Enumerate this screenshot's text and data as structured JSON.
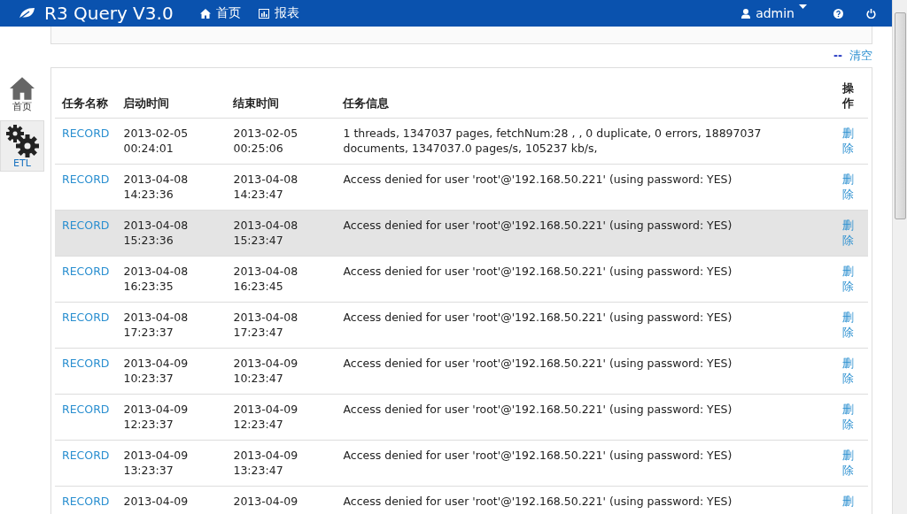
{
  "header": {
    "brand": "R3 Query V3.0",
    "nav": [
      {
        "label": "首页"
      },
      {
        "label": "报表"
      }
    ],
    "user": "admin"
  },
  "sidebar": {
    "items": [
      {
        "label": "首页",
        "selected": false
      },
      {
        "label": "ETL",
        "selected": true
      }
    ]
  },
  "toolbar": {
    "clear_prefix": "--",
    "clear": "清空"
  },
  "table": {
    "columns": [
      "任务名称",
      "启动时间",
      "结束时间",
      "任务信息",
      "操作"
    ],
    "rows": [
      {
        "name": "RECORD",
        "start": [
          "2013-02-05",
          "00:24:01"
        ],
        "end": [
          "2013-02-05",
          "00:25:06"
        ],
        "info": "1 threads, 1347037 pages, fetchNum:28 , , 0 duplicate, 0 errors, 18897037 documents, 1347037.0 pages/s, 105237 kb/s,",
        "action": "删除",
        "selected": false
      },
      {
        "name": "RECORD",
        "start": [
          "2013-04-08",
          "14:23:36"
        ],
        "end": [
          "2013-04-08",
          "14:23:47"
        ],
        "info": "Access denied for user 'root'@'192.168.50.221' (using password: YES)",
        "action": "删除",
        "selected": false
      },
      {
        "name": "RECORD",
        "start": [
          "2013-04-08",
          "15:23:36"
        ],
        "end": [
          "2013-04-08",
          "15:23:47"
        ],
        "info": "Access denied for user 'root'@'192.168.50.221' (using password: YES)",
        "action": "删除",
        "selected": true
      },
      {
        "name": "RECORD",
        "start": [
          "2013-04-08",
          "16:23:35"
        ],
        "end": [
          "2013-04-08",
          "16:23:45"
        ],
        "info": "Access denied for user 'root'@'192.168.50.221' (using password: YES)",
        "action": "删除",
        "selected": false
      },
      {
        "name": "RECORD",
        "start": [
          "2013-04-08",
          "17:23:37"
        ],
        "end": [
          "2013-04-08",
          "17:23:47"
        ],
        "info": "Access denied for user 'root'@'192.168.50.221' (using password: YES)",
        "action": "删除",
        "selected": false
      },
      {
        "name": "RECORD",
        "start": [
          "2013-04-09",
          "10:23:37"
        ],
        "end": [
          "2013-04-09",
          "10:23:47"
        ],
        "info": "Access denied for user 'root'@'192.168.50.221' (using password: YES)",
        "action": "删除",
        "selected": false
      },
      {
        "name": "RECORD",
        "start": [
          "2013-04-09",
          "12:23:37"
        ],
        "end": [
          "2013-04-09",
          "12:23:47"
        ],
        "info": "Access denied for user 'root'@'192.168.50.221' (using password: YES)",
        "action": "删除",
        "selected": false
      },
      {
        "name": "RECORD",
        "start": [
          "2013-04-09",
          "13:23:37"
        ],
        "end": [
          "2013-04-09",
          "13:23:47"
        ],
        "info": "Access denied for user 'root'@'192.168.50.221' (using password: YES)",
        "action": "删除",
        "selected": false
      },
      {
        "name": "RECORD",
        "start": [
          "2013-04-09"
        ],
        "end": [
          "2013-04-09"
        ],
        "info": "Access denied for user 'root'@'192.168.50.221' (using password: YES)",
        "action": "删",
        "selected": false
      }
    ]
  }
}
